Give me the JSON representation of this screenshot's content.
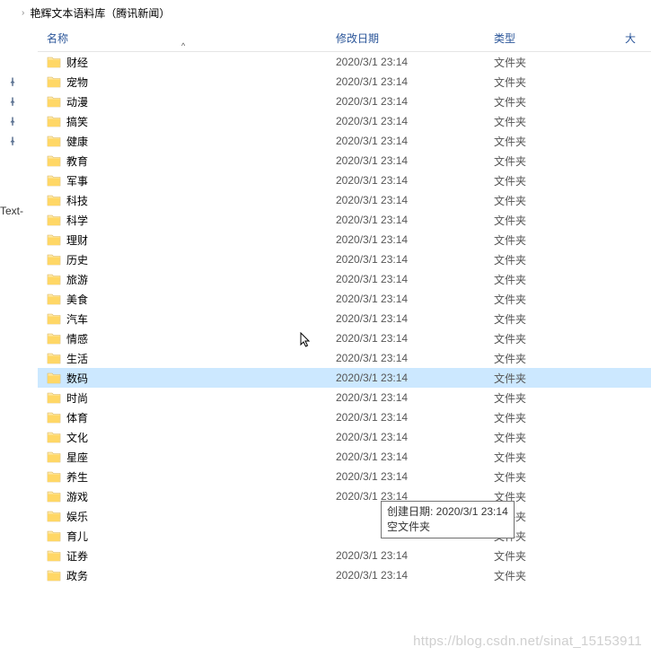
{
  "breadcrumb": {
    "text": "艳辉文本语料库（腾讯新闻）",
    "sep": "›"
  },
  "leftNav": {
    "textLabel": "-Text-"
  },
  "headers": {
    "name": "名称",
    "date": "修改日期",
    "type": "类型",
    "size": "大",
    "sortCaret": "^"
  },
  "selectedIndex": 16,
  "folders": [
    {
      "name": "财经",
      "date": "2020/3/1 23:14",
      "type": "文件夹"
    },
    {
      "name": "宠物",
      "date": "2020/3/1 23:14",
      "type": "文件夹"
    },
    {
      "name": "动漫",
      "date": "2020/3/1 23:14",
      "type": "文件夹"
    },
    {
      "name": "搞笑",
      "date": "2020/3/1 23:14",
      "type": "文件夹"
    },
    {
      "name": "健康",
      "date": "2020/3/1 23:14",
      "type": "文件夹"
    },
    {
      "name": "教育",
      "date": "2020/3/1 23:14",
      "type": "文件夹"
    },
    {
      "name": "军事",
      "date": "2020/3/1 23:14",
      "type": "文件夹"
    },
    {
      "name": "科技",
      "date": "2020/3/1 23:14",
      "type": "文件夹"
    },
    {
      "name": "科学",
      "date": "2020/3/1 23:14",
      "type": "文件夹"
    },
    {
      "name": "理财",
      "date": "2020/3/1 23:14",
      "type": "文件夹"
    },
    {
      "name": "历史",
      "date": "2020/3/1 23:14",
      "type": "文件夹"
    },
    {
      "name": "旅游",
      "date": "2020/3/1 23:14",
      "type": "文件夹"
    },
    {
      "name": "美食",
      "date": "2020/3/1 23:14",
      "type": "文件夹"
    },
    {
      "name": "汽车",
      "date": "2020/3/1 23:14",
      "type": "文件夹"
    },
    {
      "name": "情感",
      "date": "2020/3/1 23:14",
      "type": "文件夹"
    },
    {
      "name": "生活",
      "date": "2020/3/1 23:14",
      "type": "文件夹"
    },
    {
      "name": "数码",
      "date": "2020/3/1 23:14",
      "type": "文件夹"
    },
    {
      "name": "时尚",
      "date": "2020/3/1 23:14",
      "type": "文件夹"
    },
    {
      "name": "体育",
      "date": "2020/3/1 23:14",
      "type": "文件夹"
    },
    {
      "name": "文化",
      "date": "2020/3/1 23:14",
      "type": "文件夹"
    },
    {
      "name": "星座",
      "date": "2020/3/1 23:14",
      "type": "文件夹"
    },
    {
      "name": "养生",
      "date": "2020/3/1 23:14",
      "type": "文件夹"
    },
    {
      "name": "游戏",
      "date": "2020/3/1 23:14",
      "type": "文件夹"
    },
    {
      "name": "娱乐",
      "date": "",
      "type": "文件夹"
    },
    {
      "name": "育儿",
      "date": "",
      "type": "文件夹"
    },
    {
      "name": "证券",
      "date": "2020/3/1 23:14",
      "type": "文件夹"
    },
    {
      "name": "政务",
      "date": "2020/3/1 23:14",
      "type": "文件夹"
    }
  ],
  "tooltip": {
    "line1": "创建日期: 2020/3/1 23:14",
    "line2": "空文件夹"
  },
  "watermark": "https://blog.csdn.net/sinat_15153911"
}
